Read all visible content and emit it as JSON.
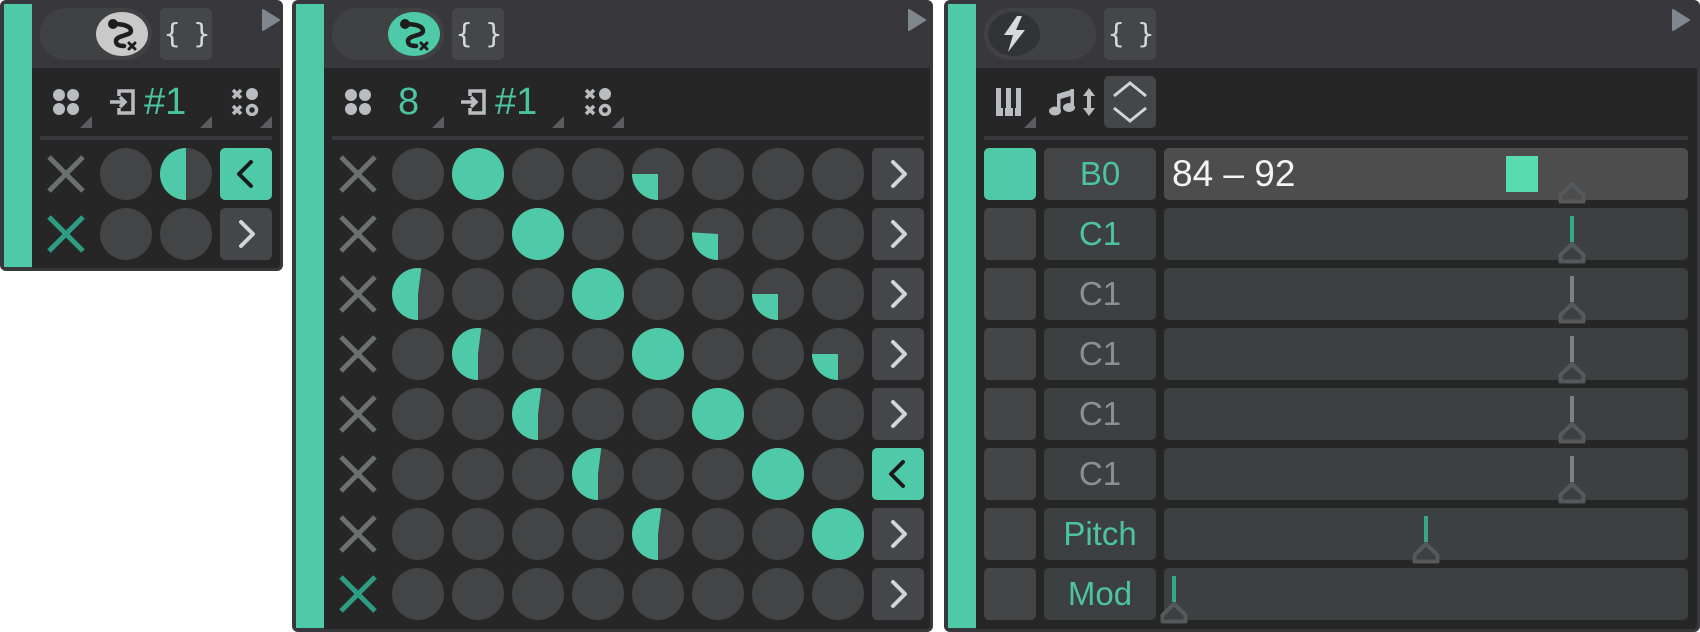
{
  "colors": {
    "accent": "#4fcaa8",
    "accent_text": "#4cc4a0",
    "cell_off": "#434446",
    "x_inactive": "#6b7070",
    "x_active": "#2e9c83",
    "name_inactive": "#8c9092",
    "line_inactive": "#7b8187",
    "marker": "#58dcb0"
  },
  "left_device": {
    "toggle": {
      "icon": "routing-icon",
      "on": false
    },
    "code_button_label": "{ }",
    "toolbar": {
      "steps_icon": "four-dots-icon",
      "input_icon": "enter-icon",
      "channel_label": "#1",
      "pattern_icon": "xo-pattern-icon"
    },
    "rows": [
      {
        "x_active": false,
        "cells": [
          0,
          0.5
        ],
        "arrow": "left",
        "arrow_active": true
      },
      {
        "x_active": true,
        "cells": [
          0,
          0
        ],
        "arrow": "right",
        "arrow_active": false
      }
    ]
  },
  "sequencer_device": {
    "toggle": {
      "icon": "routing-icon",
      "on": true
    },
    "code_button_label": "{ }",
    "toolbar": {
      "steps_icon": "four-dots-icon",
      "steps_label": "8",
      "input_icon": "enter-icon",
      "channel_label": "#1",
      "pattern_icon": "xo-pattern-icon"
    },
    "rows": [
      {
        "x_active": false,
        "cells": [
          0,
          1,
          0,
          0,
          0.25,
          0,
          0,
          0
        ],
        "arrow": "right",
        "arrow_active": false
      },
      {
        "x_active": false,
        "cells": [
          0,
          0,
          1,
          0,
          0,
          0.26,
          0,
          0
        ],
        "arrow": "right",
        "arrow_active": false
      },
      {
        "x_active": false,
        "cells": [
          0.52,
          0,
          0,
          1,
          0,
          0,
          0.25,
          0
        ],
        "arrow": "right",
        "arrow_active": false
      },
      {
        "x_active": false,
        "cells": [
          0,
          0.52,
          0,
          0,
          1,
          0,
          0,
          0.25
        ],
        "arrow": "right",
        "arrow_active": false
      },
      {
        "x_active": false,
        "cells": [
          0,
          0,
          0.52,
          0,
          0,
          1,
          0,
          0
        ],
        "arrow": "right",
        "arrow_active": false
      },
      {
        "x_active": false,
        "cells": [
          0,
          0,
          0,
          0.52,
          0,
          0,
          1,
          0
        ],
        "arrow": "left",
        "arrow_active": true
      },
      {
        "x_active": false,
        "cells": [
          0,
          0,
          0,
          0,
          0.52,
          0,
          0,
          1
        ],
        "arrow": "right",
        "arrow_active": false
      },
      {
        "x_active": true,
        "cells": [
          0,
          0,
          0,
          0,
          0,
          0,
          0,
          0
        ],
        "arrow": "right",
        "arrow_active": false
      }
    ]
  },
  "note_device": {
    "toggle": {
      "icon": "lightning-icon",
      "on": false
    },
    "code_button_label": "{ }",
    "toolbar": {
      "keys_icon": "piano-keys-icon",
      "transpose_icon": "note-updown-icon",
      "expand_icon": "chevrons-updown-icon"
    },
    "rows": [
      {
        "indicator_on": true,
        "name": "B0",
        "name_active": true,
        "highlighted": true,
        "value_text": "84 – 92",
        "marker": 0.69,
        "handle": 0.79,
        "line": "none"
      },
      {
        "indicator_on": false,
        "name": "C1",
        "name_active": true,
        "highlighted": false,
        "handle": 0.79,
        "line": "active"
      },
      {
        "indicator_on": false,
        "name": "C1",
        "name_active": false,
        "highlighted": false,
        "handle": 0.79,
        "line": "inactive"
      },
      {
        "indicator_on": false,
        "name": "C1",
        "name_active": false,
        "highlighted": false,
        "handle": 0.79,
        "line": "inactive"
      },
      {
        "indicator_on": false,
        "name": "C1",
        "name_active": false,
        "highlighted": false,
        "handle": 0.79,
        "line": "inactive"
      },
      {
        "indicator_on": false,
        "name": "C1",
        "name_active": false,
        "highlighted": false,
        "handle": 0.79,
        "line": "inactive"
      },
      {
        "indicator_on": false,
        "name": "Pitch",
        "name_active": true,
        "highlighted": false,
        "handle": 0.5,
        "line": "active"
      },
      {
        "indicator_on": false,
        "name": "Mod",
        "name_active": true,
        "highlighted": false,
        "handle": 0.0,
        "line": "active"
      }
    ]
  }
}
